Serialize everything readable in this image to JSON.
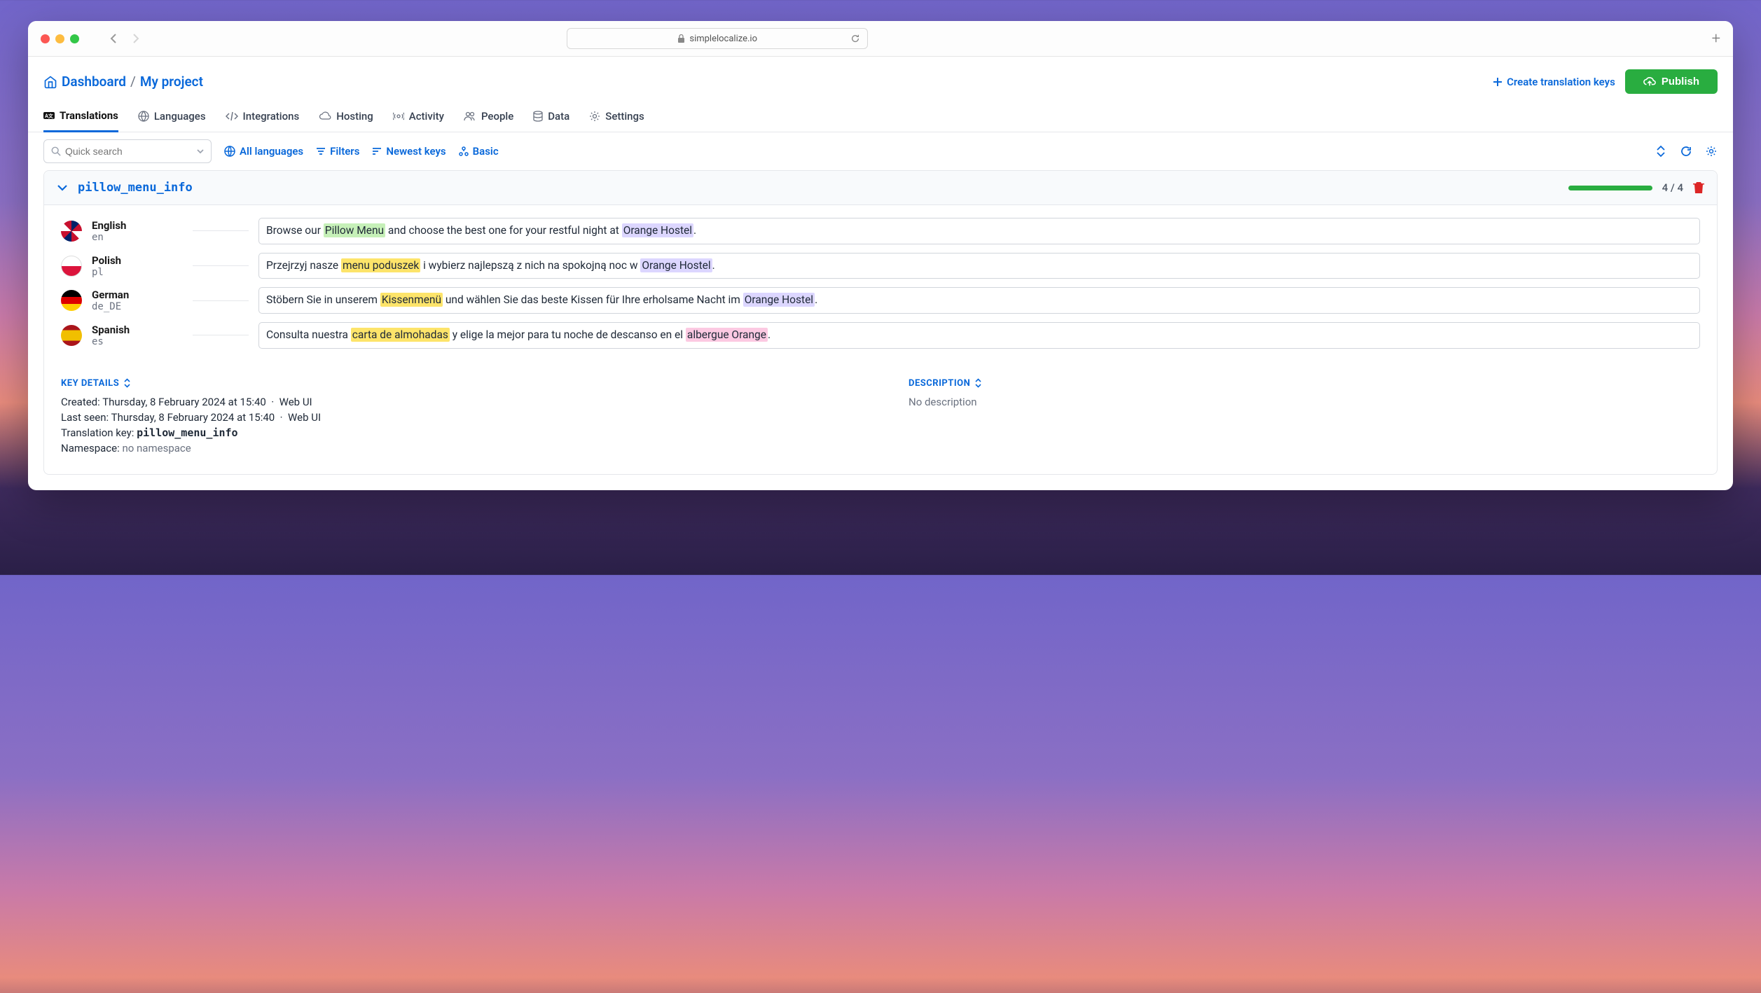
{
  "browser": {
    "url": "simplelocalize.io"
  },
  "header": {
    "breadcrumb_dashboard": "Dashboard",
    "breadcrumb_sep": "/",
    "breadcrumb_project": "My project",
    "create_keys": "Create translation keys",
    "publish": "Publish"
  },
  "tabs": [
    {
      "label": "Translations"
    },
    {
      "label": "Languages"
    },
    {
      "label": "Integrations"
    },
    {
      "label": "Hosting"
    },
    {
      "label": "Activity"
    },
    {
      "label": "People"
    },
    {
      "label": "Data"
    },
    {
      "label": "Settings"
    }
  ],
  "toolbar": {
    "search_placeholder": "Quick search",
    "all_languages": "All languages",
    "filters": "Filters",
    "newest": "Newest keys",
    "basic": "Basic"
  },
  "key": {
    "name": "pillow_menu_info",
    "progress_text": "4 / 4",
    "translations": [
      {
        "lang": "English",
        "code": "en",
        "flag": "uk",
        "segs": [
          {
            "t": "Browse our "
          },
          {
            "t": "Pillow Menu",
            "hl": "green"
          },
          {
            "t": " and choose the best one for your restful night at "
          },
          {
            "t": "Orange Hostel",
            "hl": "purple"
          },
          {
            "t": "."
          }
        ]
      },
      {
        "lang": "Polish",
        "code": "pl",
        "flag": "pl",
        "segs": [
          {
            "t": "Przejrzyj nasze "
          },
          {
            "t": "menu poduszek",
            "hl": "yellow"
          },
          {
            "t": " i wybierz najlepszą z nich na spokojną noc w "
          },
          {
            "t": "Orange Hostel",
            "hl": "purple"
          },
          {
            "t": "."
          }
        ]
      },
      {
        "lang": "German",
        "code": "de_DE",
        "flag": "de",
        "segs": [
          {
            "t": "Stöbern Sie in unserem "
          },
          {
            "t": "Kissenmenü",
            "hl": "yellow"
          },
          {
            "t": " und wählen Sie das beste Kissen für Ihre erholsame Nacht im "
          },
          {
            "t": "Orange Hostel",
            "hl": "purple"
          },
          {
            "t": "."
          }
        ]
      },
      {
        "lang": "Spanish",
        "code": "es",
        "flag": "es",
        "segs": [
          {
            "t": "Consulta nuestra "
          },
          {
            "t": "carta de almohadas",
            "hl": "yellow"
          },
          {
            "t": " y elige la mejor para tu noche de descanso en el "
          },
          {
            "t": "albergue Orange",
            "hl": "pink"
          },
          {
            "t": "."
          }
        ]
      }
    ]
  },
  "details": {
    "key_details_label": "KEY DETAILS",
    "description_label": "DESCRIPTION",
    "created_label": "Created:",
    "created_value": "Thursday, 8 February 2024 at 15:40",
    "created_source": "Web UI",
    "lastseen_label": "Last seen:",
    "lastseen_value": "Thursday, 8 February 2024 at 15:40",
    "lastseen_source": "Web UI",
    "tkey_label": "Translation key:",
    "tkey_value": "pillow_menu_info",
    "ns_label": "Namespace:",
    "ns_value": "no namespace",
    "desc_empty": "No description",
    "dot": "·"
  }
}
